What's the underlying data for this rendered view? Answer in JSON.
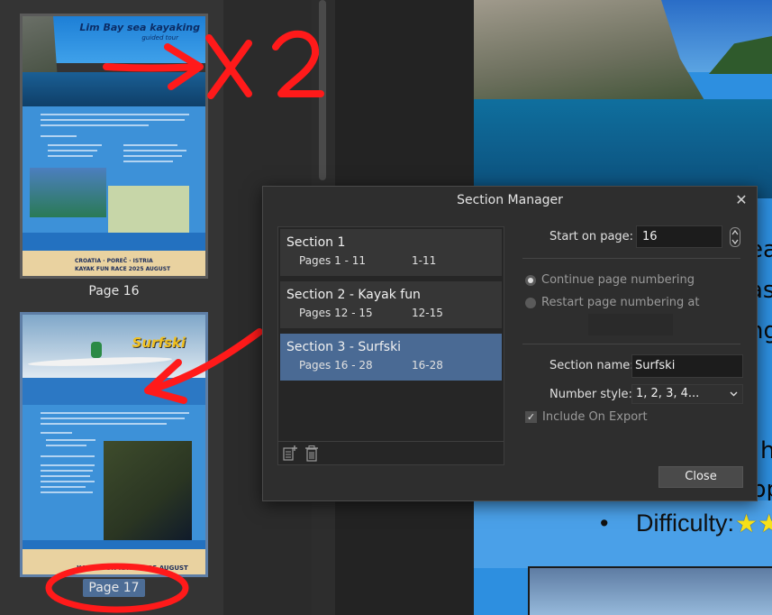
{
  "pages_panel": {
    "pages": [
      {
        "label": "Page 16",
        "thumbnail": {
          "title": "Lim Bay sea kayaking",
          "subtitle": "guided tour",
          "footer_line1": "CROATIA · POREČ · ISTRIA",
          "footer_line2": "KAYAK FUN RACE 2025 AUGUST"
        }
      },
      {
        "label": "Page 17",
        "selected": true,
        "thumbnail": {
          "title": "Surfski",
          "footer_line": "KAYAK FUN RACE 2025 AUGUST"
        }
      }
    ],
    "annotation_text": "x 2"
  },
  "document_view": {
    "visible_text_fragments": [
      "ea",
      "as",
      "ng",
      "h",
      "pp"
    ],
    "bullet": "•",
    "difficulty_label": "Difficulty:",
    "difficulty_stars": "★★"
  },
  "dialog": {
    "title": "Section Manager",
    "close_icon": "close-icon",
    "sections": [
      {
        "name": "Section 1",
        "pages": "Pages 1 - 11",
        "range": "1-11"
      },
      {
        "name": "Section 2 - Kayak fun",
        "pages": "Pages 12 - 15",
        "range": "12-15"
      },
      {
        "name": "Section 3 - Surfski",
        "pages": "Pages 16 - 28",
        "range": "16-28",
        "selected": true
      }
    ],
    "toolbar": {
      "add_icon": "add-section-icon",
      "delete_icon": "trash-icon"
    },
    "start_on_page": {
      "label": "Start on page:",
      "value": "16"
    },
    "numbering": {
      "continue_label": "Continue page numbering",
      "restart_label": "Restart page numbering at",
      "restart_value": "",
      "selected": "continue"
    },
    "section_name": {
      "label": "Section name:",
      "value": "Surfski"
    },
    "number_style": {
      "label": "Number style:",
      "value": "1, 2, 3, 4..."
    },
    "include_on_export": {
      "label": "Include On Export",
      "checked": true
    },
    "close_button": "Close"
  },
  "colors": {
    "selection": "#4a6a94",
    "dialog_bg": "#2e2e2e",
    "annotation_red": "#ff1a1a",
    "star_yellow": "#f7e11a"
  }
}
